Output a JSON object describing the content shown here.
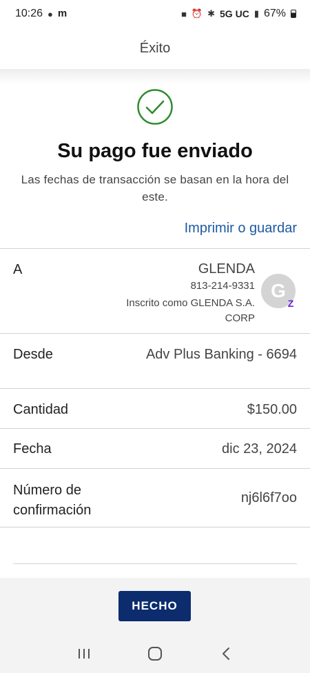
{
  "status_bar": {
    "time": "10:26",
    "network": "5G UC",
    "battery": "67%"
  },
  "header": {
    "title": "Éxito"
  },
  "confirmation": {
    "headline": "Su pago fue enviado",
    "subtext": "Las fechas de transacción se basan en la hora del este.",
    "print_link": "Imprimir o guardar"
  },
  "details": {
    "to": {
      "label": "A",
      "name": "GLENDA",
      "phone": "813-214-9331",
      "enrolled": "Inscrito como GLENDA S.A. CORP",
      "avatar_initial": "G",
      "badge": "Z"
    },
    "from": {
      "label": "Desde",
      "value": "Adv Plus Banking - 6694"
    },
    "amount": {
      "label": "Cantidad",
      "value": "$150.00"
    },
    "date": {
      "label": "Fecha",
      "value": "dic 23, 2024"
    },
    "confirmation_number": {
      "label_line1": "Número de",
      "label_line2": "confirmación",
      "value": "nj6l6f7oo"
    }
  },
  "actions": {
    "done_label": "HECHO"
  },
  "colors": {
    "accent": "#1d5aa1",
    "button": "#0c2c6e",
    "success": "#2e8b2e",
    "zelle": "#6d1ed4"
  }
}
